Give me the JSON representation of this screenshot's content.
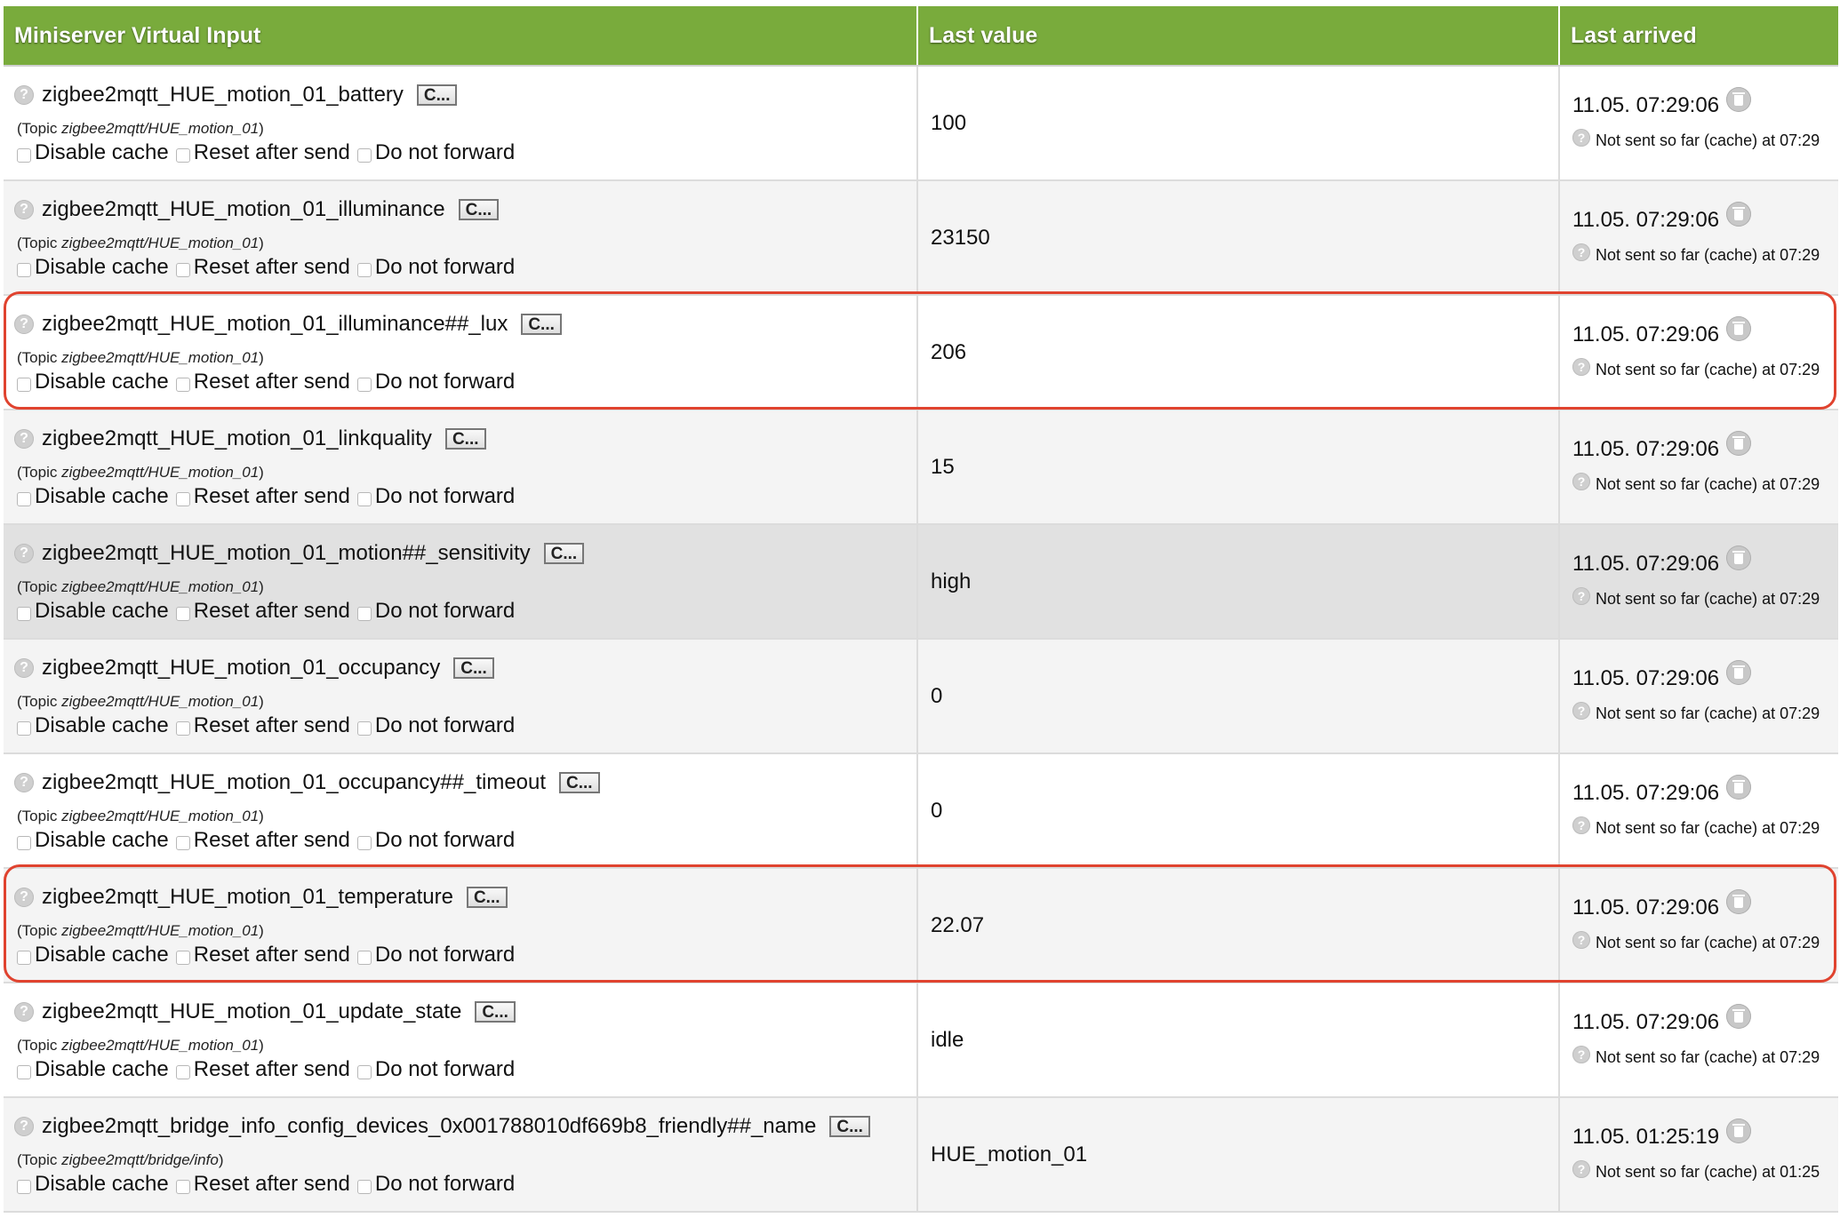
{
  "table": {
    "headers": {
      "input": "Miniserver Virtual Input",
      "value": "Last value",
      "arrived": "Last arrived"
    },
    "copy_label": "C...",
    "topic_prefix": "(Topic ",
    "topic_suffix": ")",
    "help_glyph": "?",
    "options": {
      "disable_cache": "Disable cache",
      "reset_after_send": "Reset after send",
      "do_not_forward": "Do not forward"
    },
    "rows": [
      {
        "name": "zigbee2mqtt_HUE_motion_01_battery",
        "topic": "zigbee2mqtt/HUE_motion_01",
        "value": "100",
        "arrived": "11.05. 07:29:06",
        "sent_status": "Not sent so far (cache) at 07:29",
        "highlighted": false
      },
      {
        "name": "zigbee2mqtt_HUE_motion_01_illuminance",
        "topic": "zigbee2mqtt/HUE_motion_01",
        "value": "23150",
        "arrived": "11.05. 07:29:06",
        "sent_status": "Not sent so far (cache) at 07:29",
        "highlighted": false
      },
      {
        "name": "zigbee2mqtt_HUE_motion_01_illuminance##_lux",
        "topic": "zigbee2mqtt/HUE_motion_01",
        "value": "206",
        "arrived": "11.05. 07:29:06",
        "sent_status": "Not sent so far (cache) at 07:29",
        "highlighted": true
      },
      {
        "name": "zigbee2mqtt_HUE_motion_01_linkquality",
        "topic": "zigbee2mqtt/HUE_motion_01",
        "value": "15",
        "arrived": "11.05. 07:29:06",
        "sent_status": "Not sent so far (cache) at 07:29",
        "highlighted": false
      },
      {
        "name": "zigbee2mqtt_HUE_motion_01_motion##_sensitivity",
        "topic": "zigbee2mqtt/HUE_motion_01",
        "value": "high",
        "arrived": "11.05. 07:29:06",
        "sent_status": "Not sent so far (cache) at 07:29",
        "highlighted": false
      },
      {
        "name": "zigbee2mqtt_HUE_motion_01_occupancy",
        "topic": "zigbee2mqtt/HUE_motion_01",
        "value": "0",
        "arrived": "11.05. 07:29:06",
        "sent_status": "Not sent so far (cache) at 07:29",
        "highlighted": false
      },
      {
        "name": "zigbee2mqtt_HUE_motion_01_occupancy##_timeout",
        "topic": "zigbee2mqtt/HUE_motion_01",
        "value": "0",
        "arrived": "11.05. 07:29:06",
        "sent_status": "Not sent so far (cache) at 07:29",
        "highlighted": false
      },
      {
        "name": "zigbee2mqtt_HUE_motion_01_temperature",
        "topic": "zigbee2mqtt/HUE_motion_01",
        "value": "22.07",
        "arrived": "11.05. 07:29:06",
        "sent_status": "Not sent so far (cache) at 07:29",
        "highlighted": true
      },
      {
        "name": "zigbee2mqtt_HUE_motion_01_update_state",
        "topic": "zigbee2mqtt/HUE_motion_01",
        "value": "idle",
        "arrived": "11.05. 07:29:06",
        "sent_status": "Not sent so far (cache) at 07:29",
        "highlighted": false
      },
      {
        "name": "zigbee2mqtt_bridge_info_config_devices_0x001788010df669b8_friendly##_name",
        "topic": "zigbee2mqtt/bridge/info",
        "value": "HUE_motion_01",
        "arrived": "11.05. 01:25:19",
        "sent_status": "Not sent so far (cache) at 01:25",
        "highlighted": false
      }
    ]
  },
  "colors": {
    "header_bg": "#79ab3c",
    "highlight": "#e0432f",
    "row_alt": "#f4f4f4",
    "row_hover": "#e1e1e1"
  },
  "icons": {
    "help": "help-circle-icon",
    "delete": "trash-icon",
    "info": "info-circle-icon"
  }
}
